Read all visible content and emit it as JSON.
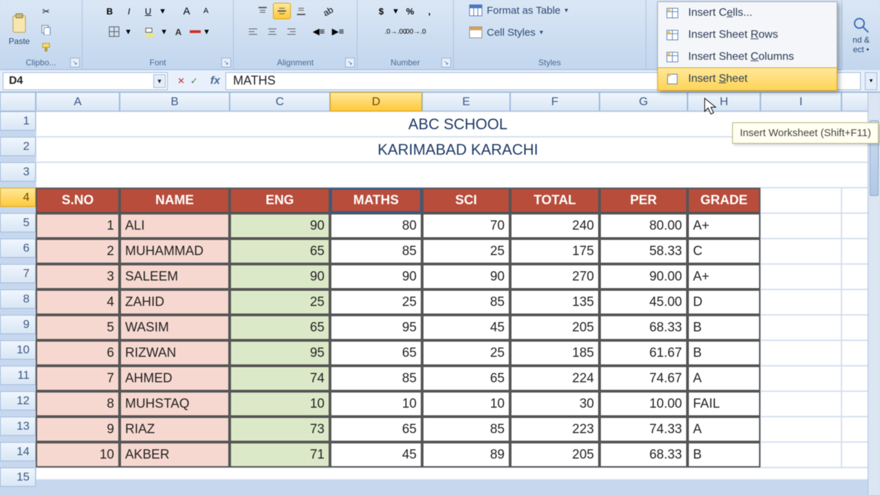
{
  "ribbon": {
    "clipboard": {
      "label": "Clipbo...",
      "paste": "Paste"
    },
    "font": {
      "label": "Font"
    },
    "alignment": {
      "label": "Alignment"
    },
    "number": {
      "label": "Number"
    },
    "styles": {
      "label": "Styles",
      "format_table": "Format as Table",
      "cell_styles": "Cell Styles"
    },
    "right_stub": "nd &\nect •"
  },
  "formula_bar": {
    "name_box": "D4",
    "formula": "MATHS"
  },
  "columns": [
    "A",
    "B",
    "C",
    "D",
    "E",
    "F",
    "G"
  ],
  "selected_col": "D",
  "selected_row": 4,
  "title1": "ABC SCHOOL",
  "title2": "KARIMABAD KARACHI",
  "table": {
    "headers": [
      "S.NO",
      "NAME",
      "ENG",
      "MATHS",
      "SCI",
      "TOTAL",
      "PER",
      "GRADE"
    ],
    "rows": [
      {
        "sno": 1,
        "name": "ALI",
        "eng": 90,
        "maths": 80,
        "sci": 70,
        "total": 240,
        "per": "80.00",
        "grade": "A+"
      },
      {
        "sno": 2,
        "name": "MUHAMMAD",
        "eng": 65,
        "maths": 85,
        "sci": 25,
        "total": 175,
        "per": "58.33",
        "grade": "C"
      },
      {
        "sno": 3,
        "name": "SALEEM",
        "eng": 90,
        "maths": 90,
        "sci": 90,
        "total": 270,
        "per": "90.00",
        "grade": "A+"
      },
      {
        "sno": 4,
        "name": "ZAHID",
        "eng": 25,
        "maths": 25,
        "sci": 85,
        "total": 135,
        "per": "45.00",
        "grade": "D"
      },
      {
        "sno": 5,
        "name": "WASIM",
        "eng": 65,
        "maths": 95,
        "sci": 45,
        "total": 205,
        "per": "68.33",
        "grade": "B"
      },
      {
        "sno": 6,
        "name": "RIZWAN",
        "eng": 95,
        "maths": 65,
        "sci": 25,
        "total": 185,
        "per": "61.67",
        "grade": "B"
      },
      {
        "sno": 7,
        "name": "AHMED",
        "eng": 74,
        "maths": 85,
        "sci": 65,
        "total": 224,
        "per": "74.67",
        "grade": "A"
      },
      {
        "sno": 8,
        "name": "MUHSTAQ",
        "eng": 10,
        "maths": 10,
        "sci": 10,
        "total": 30,
        "per": "10.00",
        "grade": "FAIL"
      },
      {
        "sno": 9,
        "name": "RIAZ",
        "eng": 73,
        "maths": 65,
        "sci": 85,
        "total": 223,
        "per": "74.33",
        "grade": "A"
      },
      {
        "sno": 10,
        "name": "AKBER",
        "eng": 71,
        "maths": 45,
        "sci": 89,
        "total": 205,
        "per": "68.33",
        "grade": "B"
      }
    ]
  },
  "menu": {
    "items": [
      {
        "label_pre": "Insert C",
        "u": "e",
        "label_post": "lls..."
      },
      {
        "label_pre": "Insert Sheet ",
        "u": "R",
        "label_post": "ows"
      },
      {
        "label_pre": "Insert Sheet ",
        "u": "C",
        "label_post": "olumns"
      },
      {
        "label_pre": "Insert ",
        "u": "S",
        "label_post": "heet"
      }
    ],
    "hovered_index": 3
  },
  "tooltip": "Insert Worksheet (Shift+F11)"
}
